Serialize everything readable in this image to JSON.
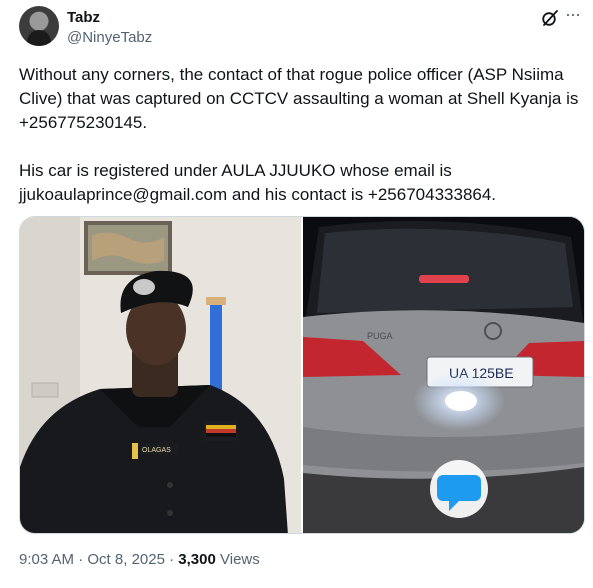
{
  "author": {
    "name": "Tabz",
    "handle": "@NinyeTabz"
  },
  "tweet": {
    "paragraph1": "Without any corners, the contact of that rogue police officer (ASP Nsiima Clive) that was captured on CCTCV assaulting a woman at Shell Kyanja is +256775230145.",
    "paragraph2": "His car is registered under AULA JJUUKO whose email is jjukoaulaprince@gmail.com and his contact is +256704333864."
  },
  "media": {
    "left_badge_text": "OLAGAS",
    "car_brand_text": "PUGA",
    "plate_text": "UA 125BE"
  },
  "meta": {
    "time": "9:03 AM",
    "separator": " · ",
    "date": "Oct 8, 2025",
    "views_count": "3,300",
    "views_label": " Views"
  },
  "icons": {
    "grok": "grok-icon",
    "more": "more-icon",
    "messages": "messages-icon"
  },
  "colors": {
    "text_primary": "#0f1419",
    "text_secondary": "#536471",
    "messages_bubble": "#1d9bf0"
  }
}
